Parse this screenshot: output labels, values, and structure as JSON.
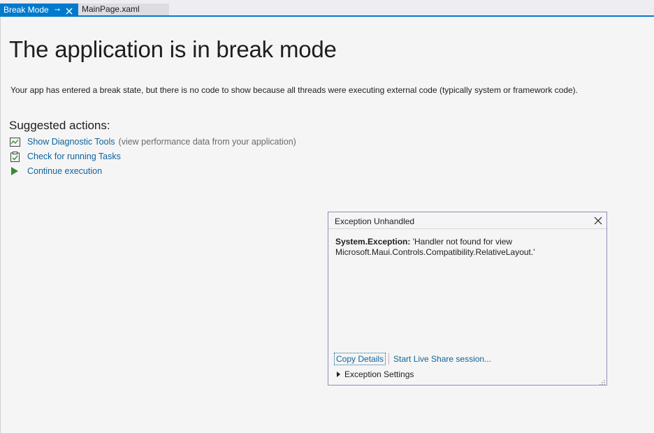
{
  "tabs": {
    "active_label": "Break Mode",
    "pin_glyph": "⊸",
    "inactive_label": "MainPage.xaml"
  },
  "page": {
    "title": "The application is in break mode",
    "description": "Your app has entered a break state, but there is no code to show because all threads were executing external code (typically system or framework code).",
    "suggested_heading": "Suggested actions:"
  },
  "actions": [
    {
      "label": "Show Diagnostic Tools",
      "note": "(view performance data from your application)",
      "icon": "diagnostic-chart-icon"
    },
    {
      "label": "Check for running Tasks",
      "note": "",
      "icon": "task-clipboard-icon"
    },
    {
      "label": "Continue execution",
      "note": "",
      "icon": "play-icon"
    }
  ],
  "popup": {
    "title": "Exception Unhandled",
    "exception_type": "System.Exception:",
    "message_line1": "'Handler not found for view",
    "message_line2": "Microsoft.Maui.Controls.Compatibility.RelativeLayout.'",
    "copy_details": "Copy Details",
    "live_share": "Start Live Share session...",
    "exception_settings": "Exception Settings"
  },
  "colors": {
    "accent": "#007acc",
    "link": "#0e639c",
    "play_green": "#388a34",
    "background": "#f5f5f5"
  }
}
